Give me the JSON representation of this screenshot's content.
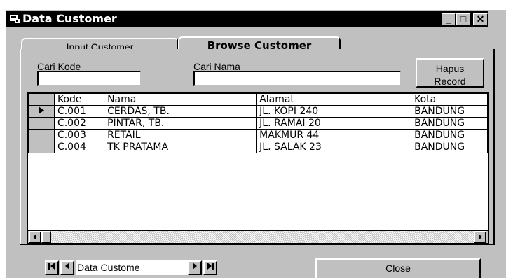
{
  "window": {
    "title": "Data Customer",
    "minimize": "_",
    "maximize": "□",
    "close": "✕"
  },
  "tabs": [
    {
      "label": "Input Customer",
      "active": false
    },
    {
      "label": "Browse Customer",
      "active": true
    }
  ],
  "search": {
    "kode_label": "Cari Kode",
    "kode_value": "",
    "nama_label": "Cari Nama",
    "nama_value": ""
  },
  "hapus_button": {
    "line1": "Hapus",
    "line2": "Record"
  },
  "grid": {
    "columns": [
      "Kode",
      "Nama",
      "Alamat",
      "Kota"
    ],
    "rows": [
      {
        "selected": true,
        "cells": [
          "C.001",
          "CERDAS, TB.",
          "JL. KOPI 240",
          "BANDUNG"
        ]
      },
      {
        "selected": false,
        "cells": [
          "C.002",
          "PINTAR, TB.",
          "JL. RAMAI 20",
          "BANDUNG"
        ]
      },
      {
        "selected": false,
        "cells": [
          "C.003",
          "RETAIL",
          "MAKMUR 44",
          "BANDUNG"
        ]
      },
      {
        "selected": false,
        "cells": [
          "C.004",
          "TK PRATAMA",
          "JL. SALAK 23",
          "BANDUNG"
        ]
      }
    ]
  },
  "data_control": {
    "caption": "Data Custome",
    "first": "first-record-icon",
    "prev": "prev-record-icon",
    "next": "next-record-icon",
    "last": "last-record-icon"
  },
  "close_button": "Close",
  "colors": {
    "face": "#c0c0c0",
    "titlebar": "#000000",
    "text": "#000000",
    "window": "#ffffff"
  }
}
